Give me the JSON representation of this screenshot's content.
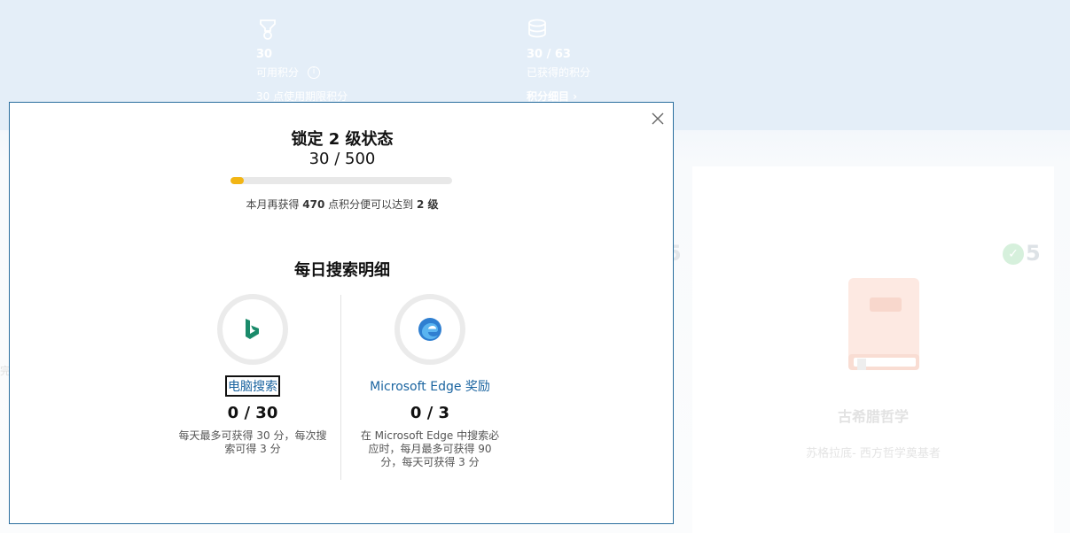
{
  "background": {
    "available_points": {
      "icon": "trophy-icon",
      "value": "30",
      "label": "可用积分",
      "info_glyph": "i",
      "sub_label": "30 点使用期限积分"
    },
    "earned_points": {
      "icon": "coins-icon",
      "value": "30 / 63",
      "label": "已获得的积分",
      "link_label": "积分细目 ›"
    },
    "card": {
      "icon": "book-icon",
      "check_glyph": "✓",
      "points": "5",
      "title": "古希腊哲学",
      "description": "苏格拉底- 西方哲学奠基者"
    },
    "left_card_points": "5",
    "edge_fragment": "完"
  },
  "modal": {
    "close_icon": "close-icon",
    "level": {
      "title": "锁定 2 级状态",
      "progress_text": "30 / 500",
      "progress_value": 30,
      "progress_max": 500,
      "hint_prefix": "本月再获得 ",
      "hint_points": "470",
      "hint_middle": " 点积分便可以达到 ",
      "hint_level": "2 级",
      "accent_color": "#f2b514"
    },
    "daily": {
      "title": "每日搜索明细",
      "items": [
        {
          "icon": "bing-icon",
          "label": "电脑搜索",
          "count": "0 / 30",
          "description": "每天最多可获得 30 分，每次搜索可得 3 分"
        },
        {
          "icon": "edge-icon",
          "label": "Microsoft Edge 奖励",
          "count": "0 / 3",
          "description": "在 Microsoft Edge 中搜索必应时，每月最多可获得 90 分，每天可获得 3 分"
        }
      ]
    }
  }
}
